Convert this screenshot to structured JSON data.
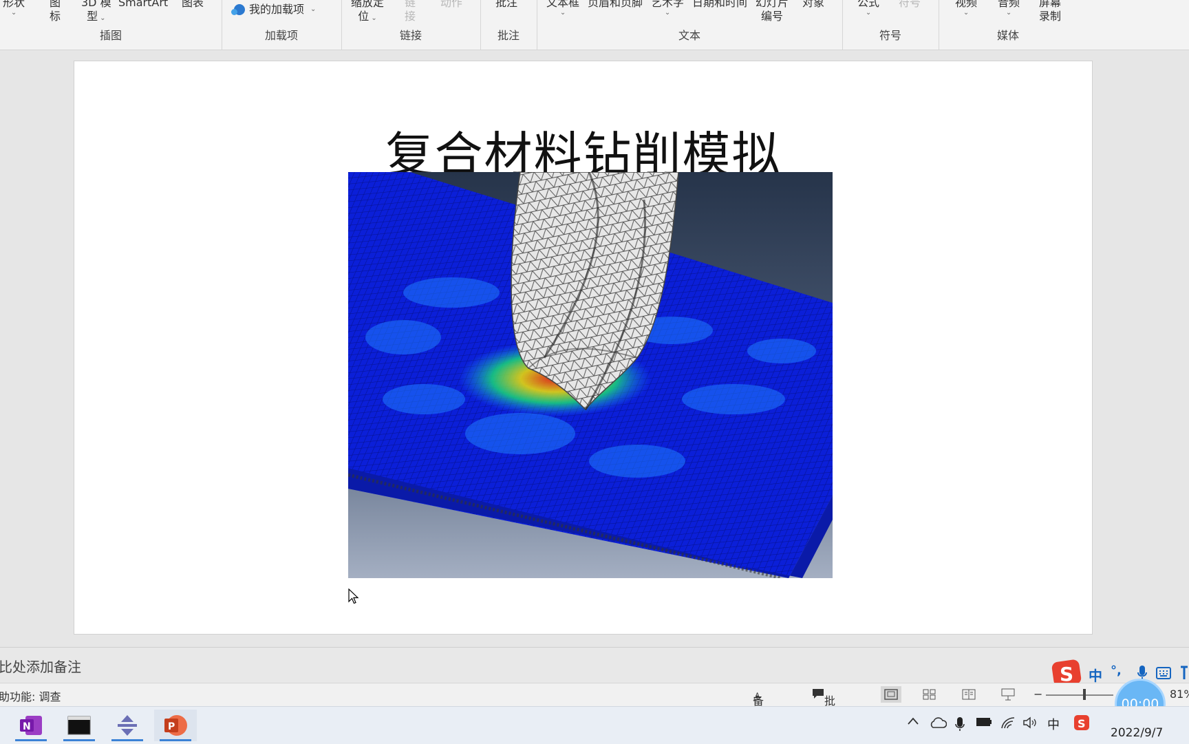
{
  "ribbon": {
    "groups": [
      {
        "label": "插图",
        "buttons": [
          {
            "label": "形状",
            "caret": true
          },
          {
            "label1": "图",
            "label2": "标"
          },
          {
            "label1": "3D 模",
            "label2": "型"
          },
          {
            "label": "SmartArt"
          },
          {
            "label": "图表"
          }
        ]
      },
      {
        "label": "加载项",
        "buttons": [
          {
            "label": "我的加载项"
          }
        ]
      },
      {
        "label": "链接",
        "buttons": [
          {
            "label1": "缩放定",
            "label2": "位"
          },
          {
            "label1": "链",
            "label2": "接"
          },
          {
            "label": "动作"
          }
        ]
      },
      {
        "label": "批注",
        "buttons": [
          {
            "label": "批注"
          }
        ]
      },
      {
        "label": "文本",
        "buttons": [
          {
            "label": "文本框"
          },
          {
            "label": "页眉和页脚"
          },
          {
            "label": "艺术字"
          },
          {
            "label": "日期和时间"
          },
          {
            "label1": "幻灯片",
            "label2": "编号"
          },
          {
            "label": "对象"
          }
        ]
      },
      {
        "label": "符号",
        "buttons": [
          {
            "label": "公式"
          },
          {
            "label": "符号"
          }
        ]
      },
      {
        "label": "媒体",
        "buttons": [
          {
            "label": "视频"
          },
          {
            "label": "音频"
          },
          {
            "label1": "屏幕",
            "label2": "录制"
          }
        ]
      }
    ]
  },
  "slide": {
    "title": "复合材料钻削模拟",
    "image_caption": "drill-composite-simulation"
  },
  "notes": {
    "placeholder": "单击此处添加备注",
    "visible_text": "比处添加备注"
  },
  "status": {
    "accessibility": "助功能: 调查",
    "notes_button": "备注",
    "comments_button": "批注",
    "zoom": "81%",
    "timer": "00:00"
  },
  "ime": {
    "mode": "中",
    "punct": "°,"
  },
  "taskbar": {
    "apps": [
      "onenote-icon",
      "terminal-icon",
      "app-icon",
      "powerpoint-icon"
    ],
    "tray_lang": "中",
    "date": "2022/9/7"
  },
  "colors": {
    "accent": "#3b82d6",
    "sogou": "#e8402f",
    "timer": "#6ab7f5"
  }
}
